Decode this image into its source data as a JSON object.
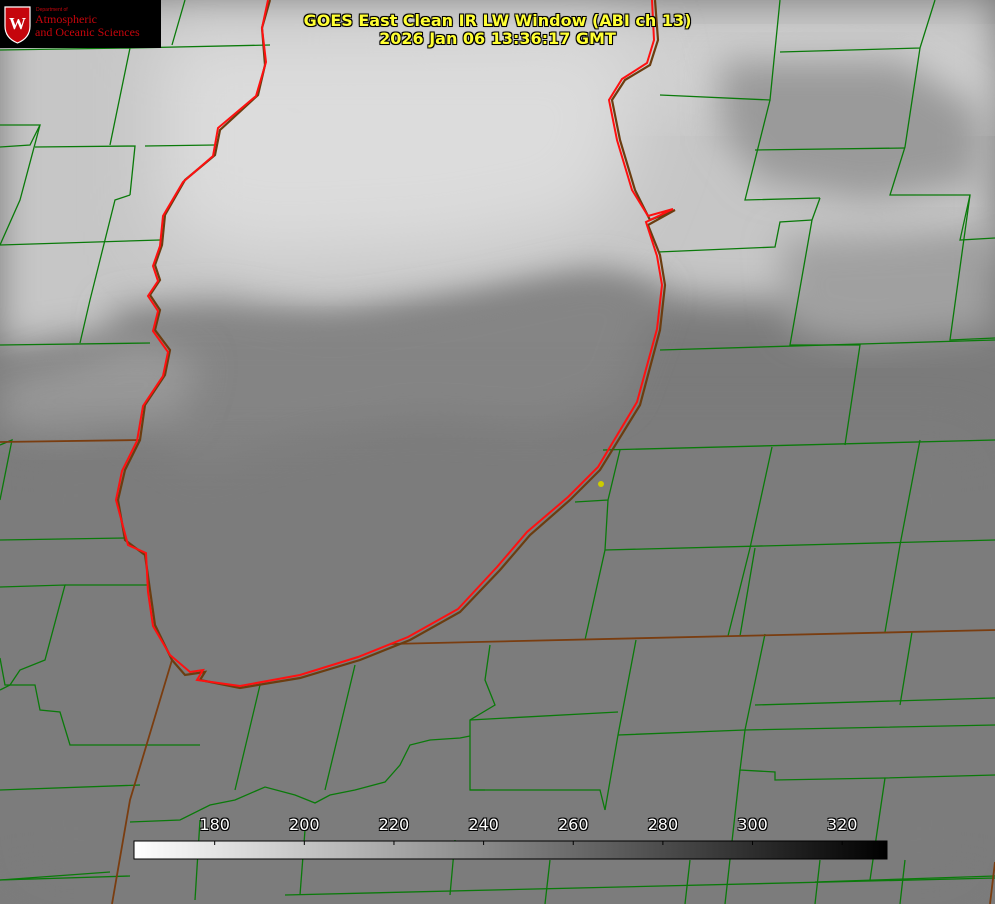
{
  "title": {
    "line1": "GOES East Clean IR LW Window (ABI ch 13)",
    "line2": "2026 Jan 06 13:36:17 GMT"
  },
  "logo": {
    "small_text": "Department of",
    "line1": "Atmospheric",
    "line2": "and Oceanic Sciences",
    "seal_letter": "W"
  },
  "colorbar": {
    "min": 162,
    "max": 330,
    "ticks": [
      180,
      200,
      220,
      240,
      260,
      280,
      300,
      320
    ],
    "colormap": "white-to-black (cold bright, warm dark)"
  },
  "colors": {
    "county_lines": "#008000",
    "state_lines": "#8b4513",
    "lake_outline": "#ff0000",
    "marker": "#cccc00",
    "title_text": "#ffff33",
    "logo_red": "#c5050c"
  },
  "features": {
    "lake": "Lake Michigan outline",
    "marker": "yellow point near eastern shore"
  }
}
